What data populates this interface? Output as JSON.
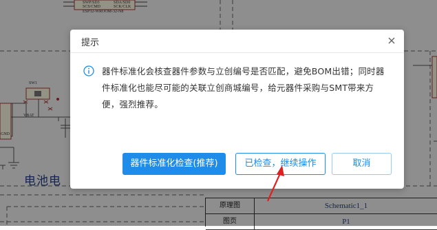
{
  "schematic": {
    "top_chip_lines": [
      "SWP/SD3",
      "SCS/CMD",
      "ESP32-WROOM-32-N8"
    ],
    "top_chip_lines_right": [
      "SDA/SD0",
      "SCK/CLK"
    ],
    "sw_label": "SW1",
    "vbat_label": "VBAT",
    "gnd_label": "GND",
    "big_text": "电池电",
    "title_block": {
      "rows": [
        {
          "key": "原理图",
          "value": "Schematic1_1"
        },
        {
          "key": "图页",
          "value": "P1"
        }
      ]
    }
  },
  "dialog": {
    "title": "提示",
    "message": "器件标准化会核查器件参数与立创编号是否匹配，避免BOM出错；同时器件标准化也能尽可能的关联立创商城编号，给元器件采购与SMT带来方便，强烈推荐。",
    "buttons": {
      "primary": "器件标准化检查(推荐)",
      "continue": "已检查，继续操作",
      "cancel": "取消"
    }
  },
  "colors": {
    "primary": "#1e8ce8",
    "annotation_arrow": "#e02020",
    "info_icon": "#1e8ce8"
  },
  "icons": {
    "close": "close-icon",
    "info": "info-icon"
  }
}
